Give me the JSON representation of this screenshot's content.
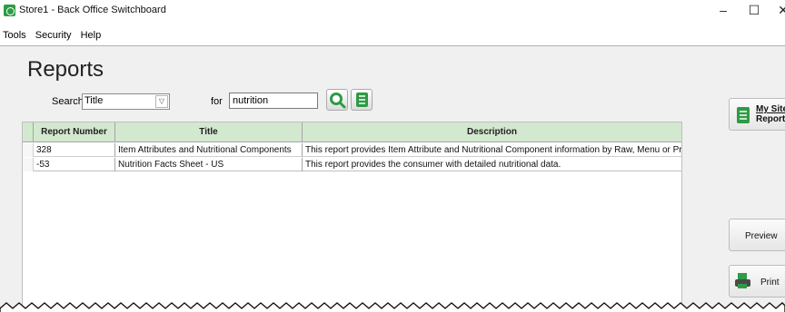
{
  "window": {
    "title": "Store1 - Back Office Switchboard",
    "minimize": "–",
    "maximize": "☐",
    "close": "✕"
  },
  "menu": {
    "items": [
      "Tools",
      "Security",
      "Help"
    ]
  },
  "page": {
    "heading": "Reports"
  },
  "search": {
    "label": "Search",
    "field_value": "Title",
    "for_label": "for",
    "query": "nutrition"
  },
  "table": {
    "columns": [
      "Report Number",
      "Title",
      "Description"
    ],
    "rows": [
      {
        "number": "328",
        "title": "Item Attributes and Nutritional Components",
        "description": "This report provides Item Attribute and Nutritional Component information by Raw, Menu or Prep item"
      },
      {
        "number": "-53",
        "title": "Nutrition Facts Sheet - US",
        "description": "This report provides the consumer with detailed nutritional data."
      }
    ]
  },
  "side_buttons": {
    "my_site_reports": [
      "My Site",
      "Reports"
    ],
    "preview": "Preview",
    "print": "Print"
  },
  "colors": {
    "header_green": "#d3e9cf",
    "icon_green": "#2e9b45"
  }
}
